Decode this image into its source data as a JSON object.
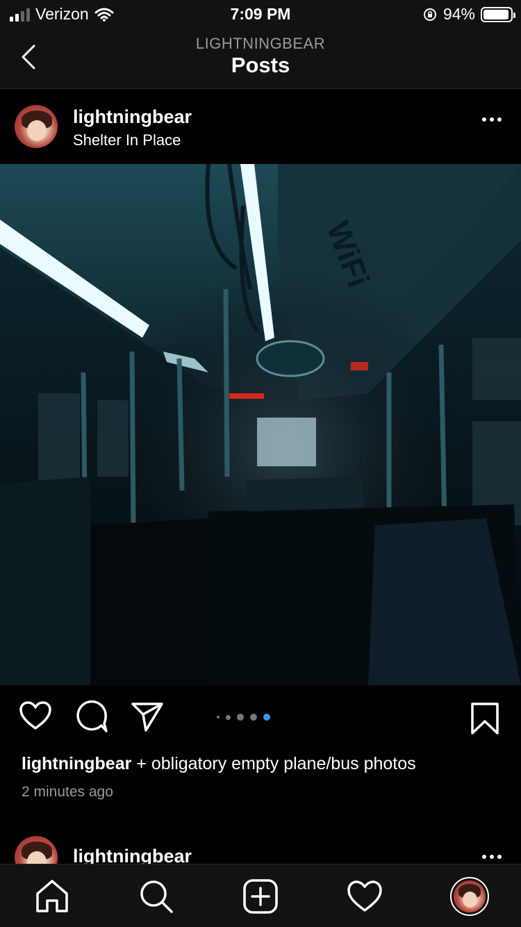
{
  "status_bar": {
    "carrier": "Verizon",
    "time": "7:09 PM",
    "battery": "94%",
    "battery_level": 0.94
  },
  "nav": {
    "subtitle": "LIGHTNINGBEAR",
    "title": "Posts"
  },
  "post": {
    "username": "lightningbear",
    "location": "Shelter In Place",
    "caption": "+ obligatory empty plane/bus photos",
    "time_ago": "2 minutes ago",
    "carousel": {
      "count": 5,
      "active_index": 4
    }
  },
  "next_post": {
    "username": "lightningbear"
  },
  "icons": {
    "back": "chevron-left-icon",
    "more": "more-horizontal-icon",
    "like": "heart-icon",
    "comment": "comment-icon",
    "share": "send-icon",
    "save": "bookmark-icon",
    "home": "home-icon",
    "search": "search-icon",
    "new_post": "plus-square-icon",
    "activity": "heart-icon",
    "profile": "avatar"
  },
  "colors": {
    "background": "#000000",
    "bar": "#121212",
    "accent": "#3897f0",
    "muted": "#9a9a9a"
  }
}
